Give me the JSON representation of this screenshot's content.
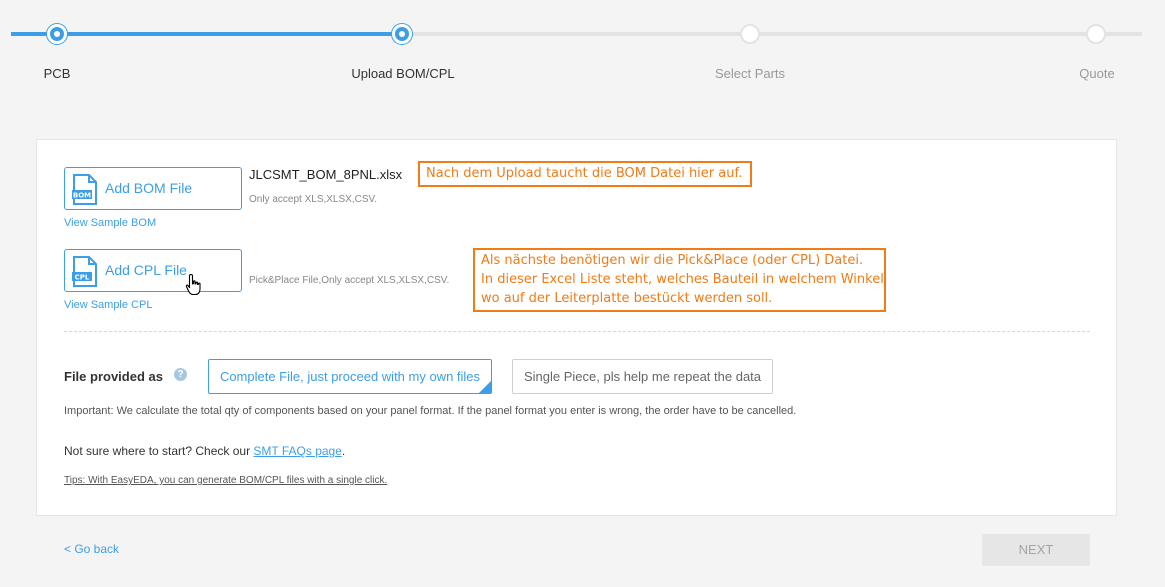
{
  "stepper": {
    "steps": [
      {
        "label": "PCB",
        "state": "done"
      },
      {
        "label": "Upload BOM/CPL",
        "state": "current"
      },
      {
        "label": "Select Parts",
        "state": "todo"
      },
      {
        "label": "Quote",
        "state": "todo"
      }
    ],
    "accent_color": "#3d9ee8"
  },
  "bom": {
    "button_label": "Add BOM File",
    "icon": "bom-file-icon",
    "icon_text": "BOM",
    "file_name": "JLCSMT_BOM_8PNL.xlsx",
    "hint": "Only accept XLS,XLSX,CSV.",
    "sample_link": "View Sample BOM"
  },
  "cpl": {
    "button_label": "Add CPL File",
    "icon": "cpl-file-icon",
    "icon_text": "CPL",
    "hint": "Pick&Place File,Only accept XLS,XLSX,CSV.",
    "sample_link": "View Sample CPL"
  },
  "annotations": {
    "bom_note": "Nach dem Upload taucht die BOM Datei hier auf.",
    "cpl_note_lines": [
      "Als nächste benötigen wir die Pick&Place (oder CPL) Datei.",
      "In dieser Excel Liste steht, welches Bauteil in welchem Winkel",
      "wo auf der Leiterplatte bestückt werden soll."
    ],
    "color": "#f07b17"
  },
  "provided": {
    "label": "File provided as",
    "help_icon": "question-icon",
    "options": [
      {
        "label": "Complete File, just proceed with my own files",
        "selected": true
      },
      {
        "label": "Single Piece, pls help me repeat the data",
        "selected": false
      }
    ]
  },
  "important_text": "Important: We calculate the total qty of components based on your panel format. If the panel format you enter is wrong, the order have to be cancelled.",
  "help": {
    "prefix": "Not sure where to start? Check our ",
    "link": "SMT FAQs page",
    "suffix": "."
  },
  "tips": "Tips: With EasyEDA, you can generate BOM/CPL files with a single click.",
  "footer": {
    "back_label": "< Go back",
    "next_label": "NEXT"
  }
}
